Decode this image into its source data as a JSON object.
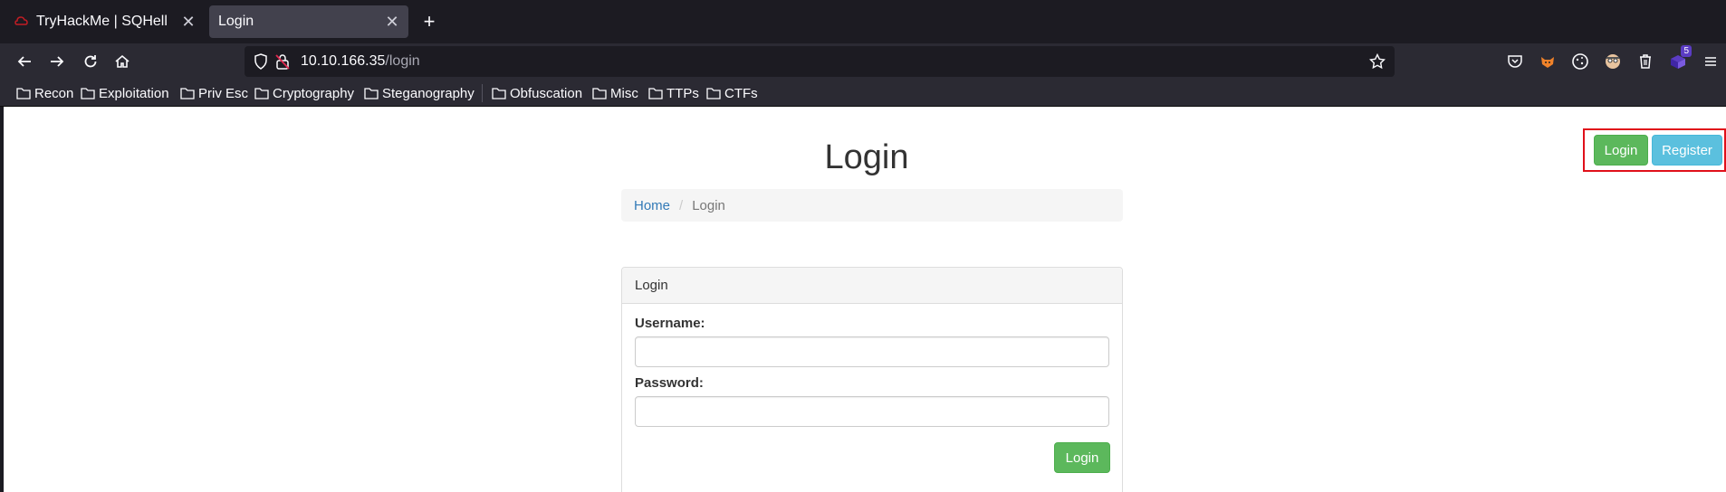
{
  "browser": {
    "tabs": [
      {
        "title": "TryHackMe | SQHell",
        "active": false
      },
      {
        "title": "Login",
        "active": true
      }
    ],
    "url": {
      "host": "10.10.166.35",
      "path": "/login"
    },
    "extension_badge": "5",
    "bookmarks": [
      "Recon",
      "Exploitation",
      "Priv Esc",
      "Cryptography",
      "Steganography",
      "Obfuscation",
      "Misc",
      "TTPs",
      "CTFs"
    ]
  },
  "page": {
    "title": "Login",
    "breadcrumb": {
      "home": "Home",
      "separator": "/",
      "current": "Login"
    },
    "top_actions": {
      "login_label": "Login",
      "register_label": "Register"
    },
    "panel": {
      "heading": "Login",
      "username_label": "Username:",
      "password_label": "Password:",
      "submit_label": "Login"
    }
  },
  "colors": {
    "success": "#5cb85c",
    "info": "#5bc0de",
    "highlight": "#e0101a",
    "link": "#337ab7"
  }
}
